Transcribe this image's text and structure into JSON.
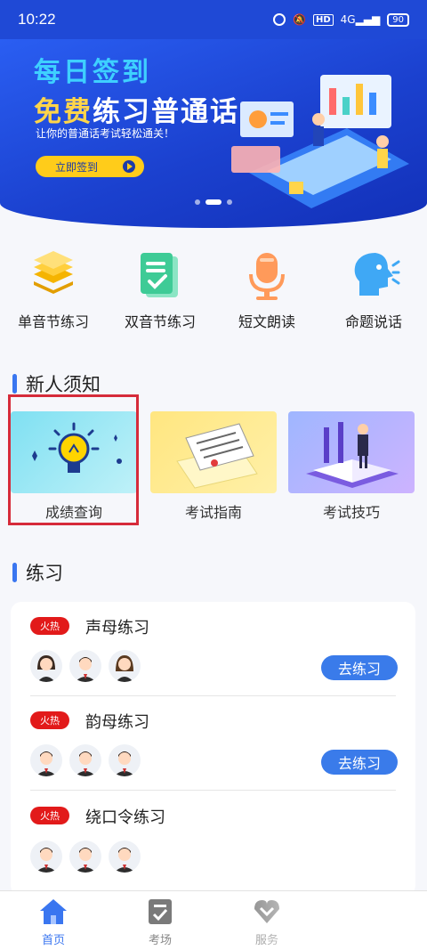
{
  "status_bar": {
    "time": "10:22",
    "network": "4G",
    "hd": "HD",
    "battery": "90"
  },
  "banner": {
    "title1": "每日签到",
    "title2_highlight": "免费",
    "title2_rest": "练习普通话",
    "subtitle": "让你的普通话考试轻松通关！",
    "button_label": "立即签到",
    "slide_count": 3,
    "active_slide": 1
  },
  "features": [
    {
      "label": "单音节练习",
      "icon": "stacked-layers-icon"
    },
    {
      "label": "双音节练习",
      "icon": "checklist-icon"
    },
    {
      "label": "短文朗读",
      "icon": "microphone-icon"
    },
    {
      "label": "命题说话",
      "icon": "speaking-head-icon"
    }
  ],
  "new_user": {
    "title": "新人须知",
    "cards": [
      {
        "label": "成绩查询",
        "icon": "lightbulb-icon"
      },
      {
        "label": "考试指南",
        "icon": "documents-icon"
      },
      {
        "label": "考试技巧",
        "icon": "book-person-icon"
      }
    ]
  },
  "practice": {
    "title": "练习",
    "items": [
      {
        "badge": "火热",
        "name": "声母练习",
        "button": "去练习",
        "avatars": [
          "female",
          "male",
          "female"
        ]
      },
      {
        "badge": "火热",
        "name": "韵母练习",
        "button": "去练习",
        "avatars": [
          "male",
          "male",
          "male"
        ]
      },
      {
        "badge": "火热",
        "name": "绕口令练习",
        "button": "",
        "avatars": [
          "male",
          "male",
          "male"
        ]
      }
    ]
  },
  "tabbar": {
    "tabs": [
      {
        "label": "首页",
        "icon": "home-icon",
        "active": true
      },
      {
        "label": "考场",
        "icon": "exam-icon",
        "active": false
      },
      {
        "label": "服务",
        "icon": "service-icon",
        "active": false
      }
    ]
  },
  "colors": {
    "primary": "#3a76f0",
    "banner": "#1f49d6",
    "hot": "#e21a1a",
    "highlight_box": "#d62b3a"
  }
}
